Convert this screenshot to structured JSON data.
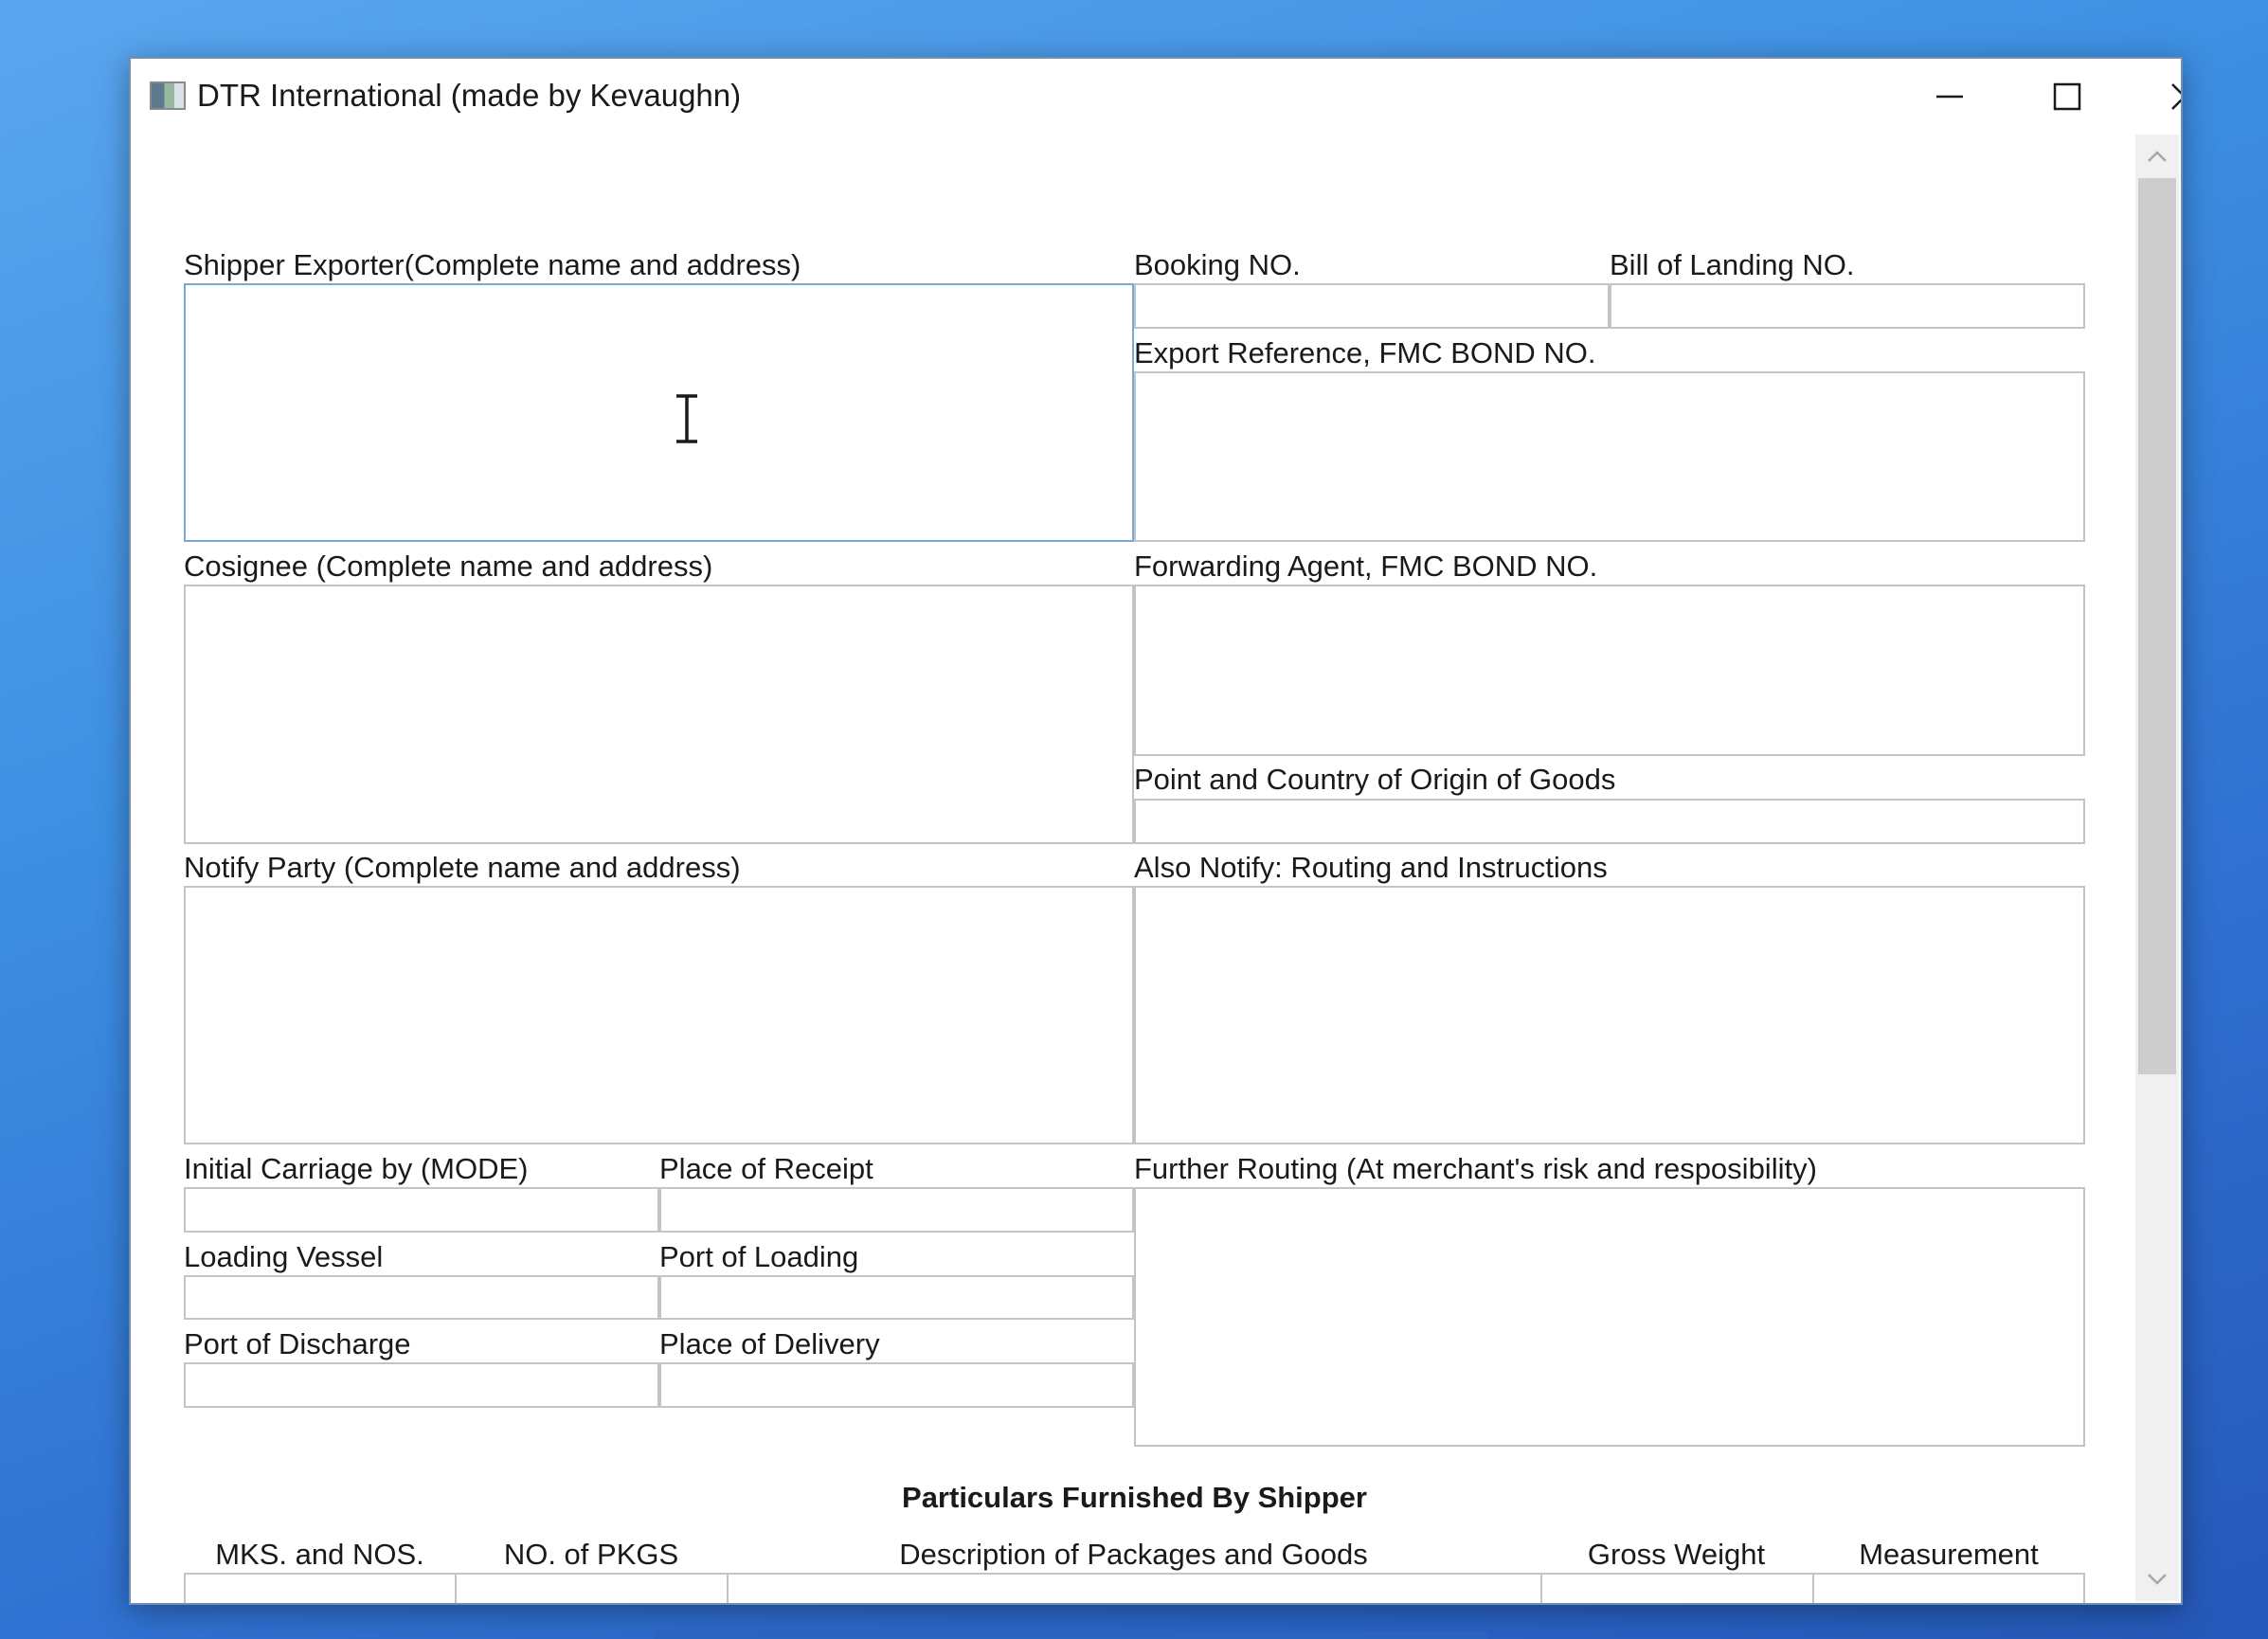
{
  "window": {
    "title": "DTR International (made by Kevaughn)",
    "icons": {
      "app": "app-icon",
      "minimize": "minimize-icon",
      "maximize": "maximize-icon",
      "close": "close-icon"
    }
  },
  "form": {
    "shipper_exporter": "Shipper Exporter(Complete name and address)",
    "booking_no": "Booking NO.",
    "bill_of_landing_no": "Bill of Landing NO.",
    "export_reference": "Export Reference, FMC BOND NO.",
    "consignee": "Cosignee (Complete name and address)",
    "forwarding_agent": "Forwarding Agent, FMC BOND NO.",
    "point_country_origin": "Point and Country of Origin of Goods",
    "notify_party": "Notify Party (Complete name and address)",
    "also_notify": "Also Notify: Routing and Instructions",
    "initial_carriage": "Initial Carriage by (MODE)",
    "place_of_receipt": "Place of Receipt",
    "further_routing": "Further Routing (At merchant's risk and resposibility)",
    "loading_vessel": "Loading Vessel",
    "port_of_loading": "Port of Loading",
    "port_of_discharge": "Port of Discharge",
    "place_of_delivery": "Place of Delivery"
  },
  "particulars": {
    "heading": "Particulars Furnished By Shipper",
    "columns": [
      "MKS. and NOS.",
      "NO. of PKGS",
      "Description of Packages and Goods",
      "Gross Weight",
      "Measurement"
    ]
  },
  "colors": {
    "field_border": "#c4c4c4",
    "focused_border": "#7ea6d6",
    "scrollbar_thumb": "#cdcdcd"
  }
}
